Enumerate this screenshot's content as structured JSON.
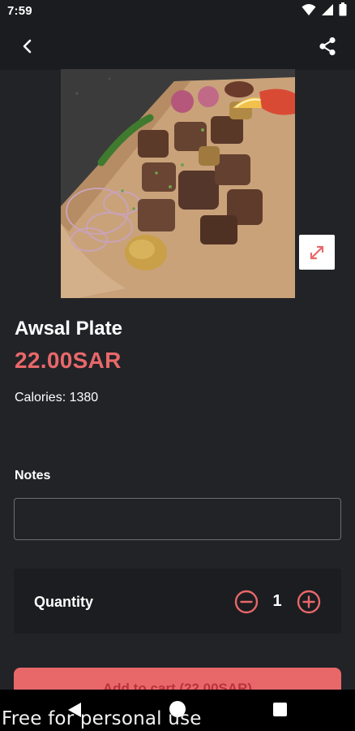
{
  "status_bar": {
    "time": "7:59",
    "icons": [
      "wifi-icon",
      "signal-icon",
      "battery-icon"
    ]
  },
  "app_bar": {
    "icons": [
      "back-arrow-icon",
      "share-icon"
    ]
  },
  "product": {
    "image_icon": "expand-icon",
    "title": "Awsal Plate",
    "price": "22.00SAR",
    "calories_text": "Calories: 1380"
  },
  "notes": {
    "label": "Notes",
    "value": "",
    "placeholder": ""
  },
  "quantity": {
    "label": "Quantity",
    "value": "1",
    "icons": [
      "minus-circle-icon",
      "plus-circle-icon"
    ]
  },
  "add_to_cart": {
    "label": "Add to cart (22.00SAR)"
  },
  "system_nav": {
    "icons": [
      "nav-back-icon",
      "nav-home-icon",
      "nav-recents-icon"
    ]
  },
  "watermark": "Free for personal use",
  "colors": {
    "background": "#222327",
    "accent": "#e8686a",
    "card": "#1c1d20"
  }
}
